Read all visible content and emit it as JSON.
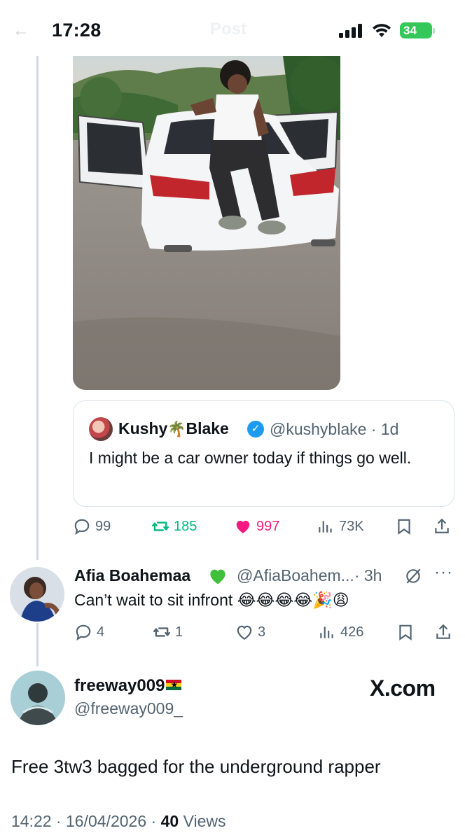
{
  "status_bar": {
    "time": "17:28",
    "battery": "34",
    "title": "Post",
    "icons": [
      "back-arrow-icon",
      "signal-icon",
      "wifi-icon",
      "battery-icon"
    ]
  },
  "parent_post": {
    "photo": {
      "scene": "car-photo"
    },
    "quoted": {
      "name_first": "Kushy",
      "name_emoji": "🌴",
      "name_last": "Blake",
      "handle": "@kushyblake",
      "time": "· 1d",
      "text": "I might be a car owner today if things go well."
    },
    "actions": {
      "replies": "99",
      "reposts": "185",
      "likes": "997",
      "views": "73K"
    },
    "colors": {
      "repost": "#00ba7c",
      "like": "#f91880"
    }
  },
  "reply": {
    "name": "Afia Boahemaa",
    "handle": "@AfiaBoahem...",
    "time": "· 3h",
    "text": "Can’t wait to sit infront 😂😂😂😂🎉😩",
    "actions": {
      "replies": "4",
      "reposts": "1",
      "likes": "3",
      "views": "426"
    }
  },
  "main_post": {
    "name": "freeway009",
    "handle": "@freeway009_",
    "watermark": "X.com",
    "text": "Free 3tw3 bagged for the underground rapper",
    "time": "14:22",
    "date": "16/04/2026",
    "views_count": "40",
    "views_label": "Views"
  },
  "colors": {
    "text": "#0f1419",
    "secondary": "#536471",
    "verified": "#1d9bf0",
    "border": "#cfd9de"
  }
}
